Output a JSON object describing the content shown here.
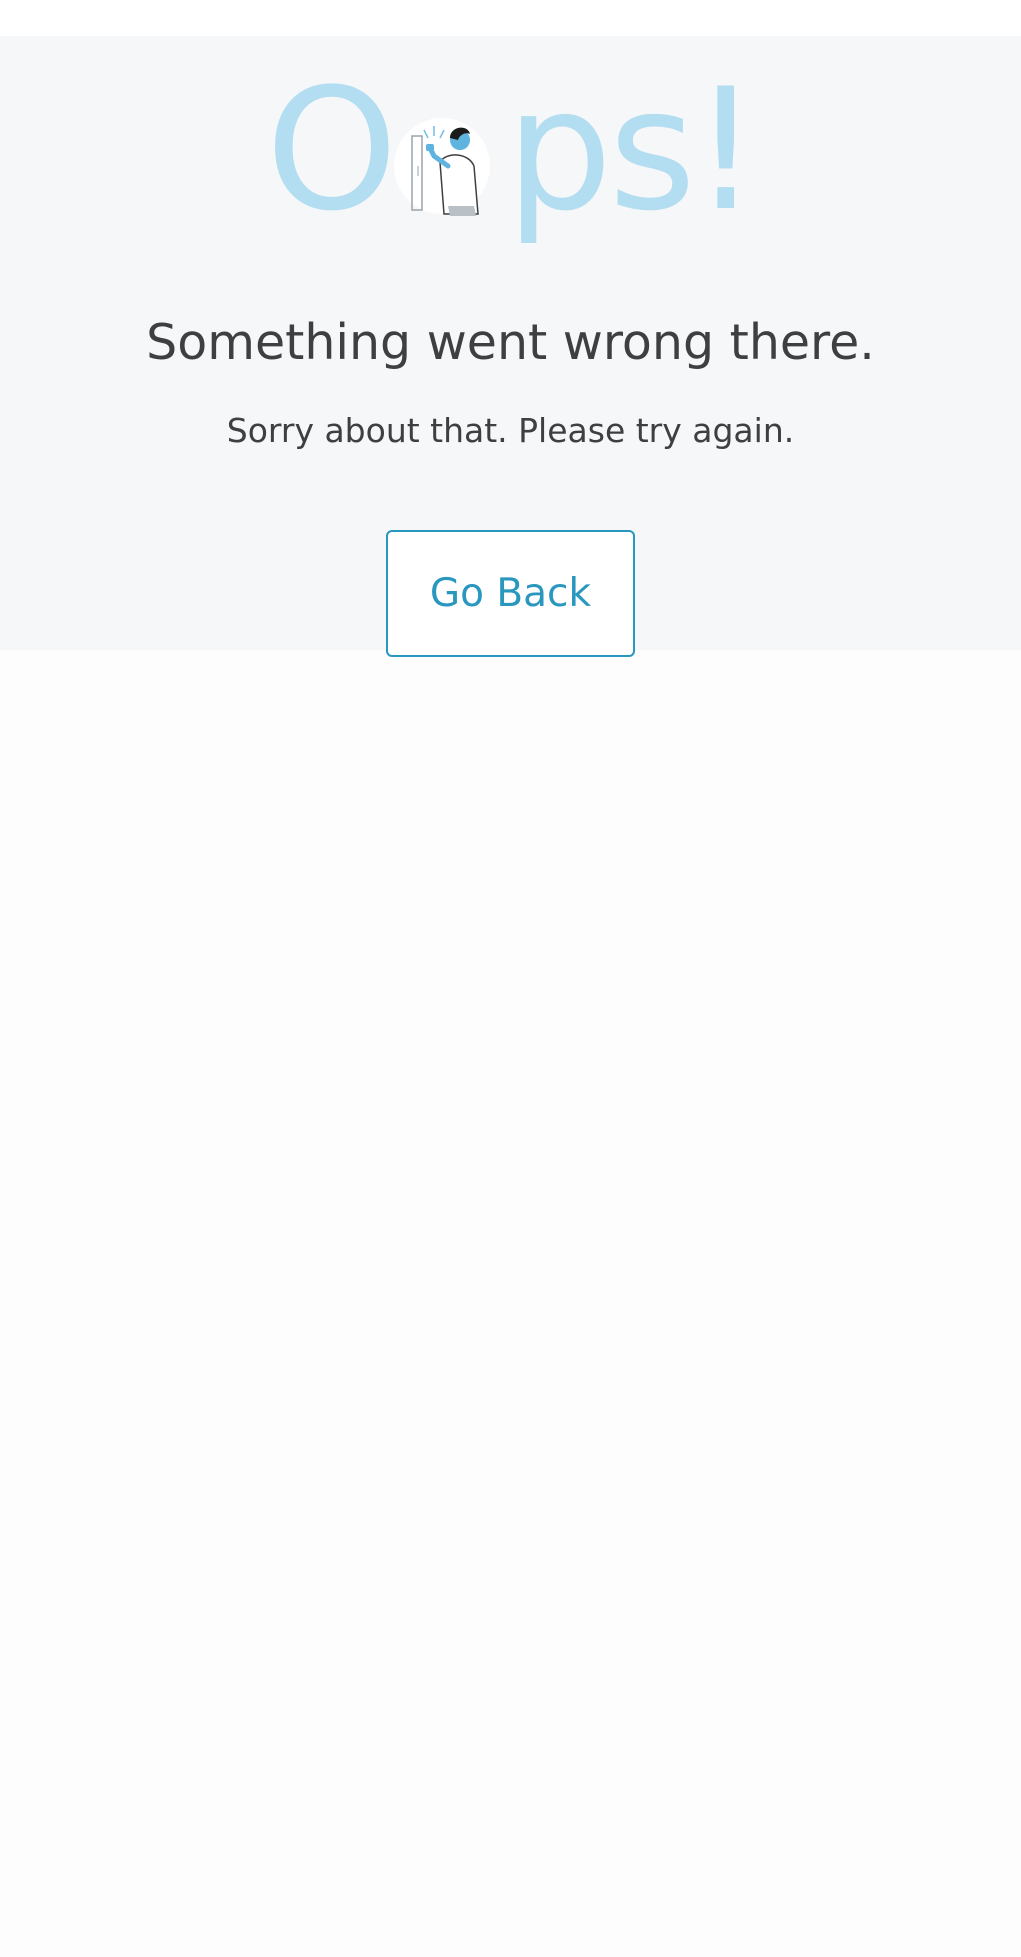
{
  "error": {
    "oops_letters": [
      "O",
      "ps!"
    ],
    "headline": "Something went wrong there.",
    "message": "Sorry about that. Please try again.",
    "go_back_label": "Go Back"
  },
  "colors": {
    "oops_text": "#b3ddf0",
    "heading_text": "#3e3f41",
    "accent": "#2a97bf",
    "panel_background": "#f6f7f9"
  },
  "icons": {
    "illustration": "person-knocking-on-door-illustration"
  }
}
